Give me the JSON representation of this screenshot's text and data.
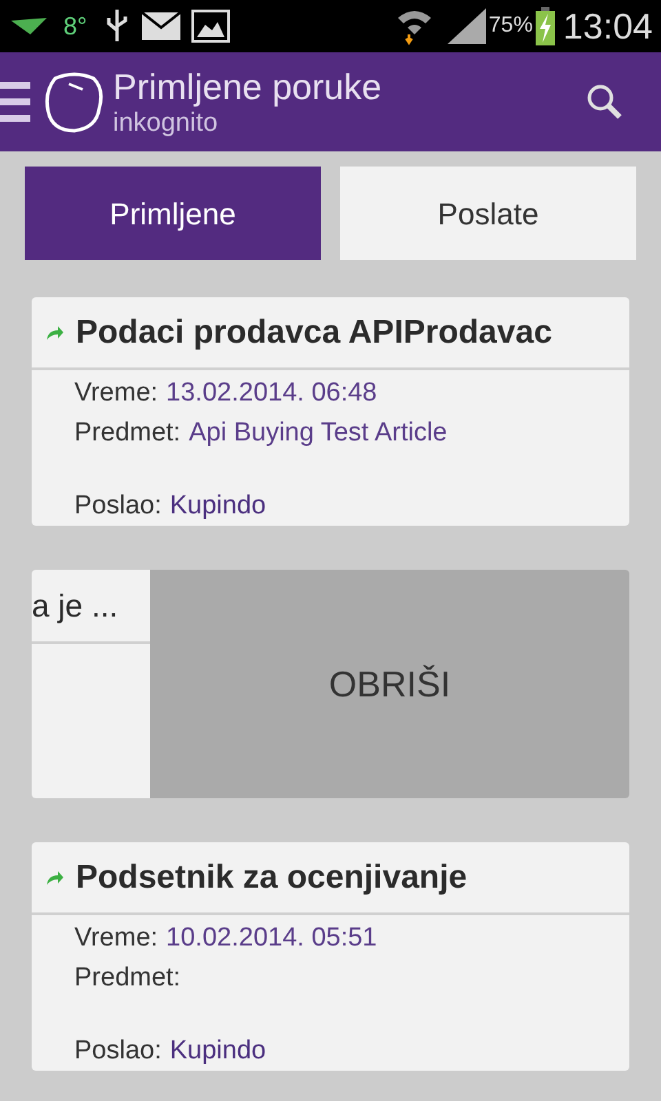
{
  "status_bar": {
    "temperature": "8°",
    "battery": "75%",
    "time": "13:04"
  },
  "app_bar": {
    "title": "Primljene poruke",
    "subtitle": "inkognito"
  },
  "tabs": [
    {
      "label": "Primljene",
      "selected": true
    },
    {
      "label": "Poslate",
      "selected": false
    }
  ],
  "messages": [
    {
      "kind": "message",
      "title": "Podaci prodavca APIProdavac",
      "fields": [
        {
          "label": "Vreme:",
          "value": "13.02.2014. 06:48"
        },
        {
          "label": "Predmet:",
          "value": "Api Buying Test Article"
        }
      ],
      "sender_label": "Poslao:",
      "sender": "Kupindo"
    },
    {
      "kind": "swiped",
      "title": "a je ...",
      "action": "OBRIŠI"
    },
    {
      "kind": "message",
      "title": "Podsetnik za ocenjivanje",
      "fields": [
        {
          "label": "Vreme:",
          "value": "10.02.2014. 05:51"
        },
        {
          "label": "Predmet:"
        }
      ],
      "sender_label": "Poslao:",
      "sender": "Kupindo"
    }
  ]
}
